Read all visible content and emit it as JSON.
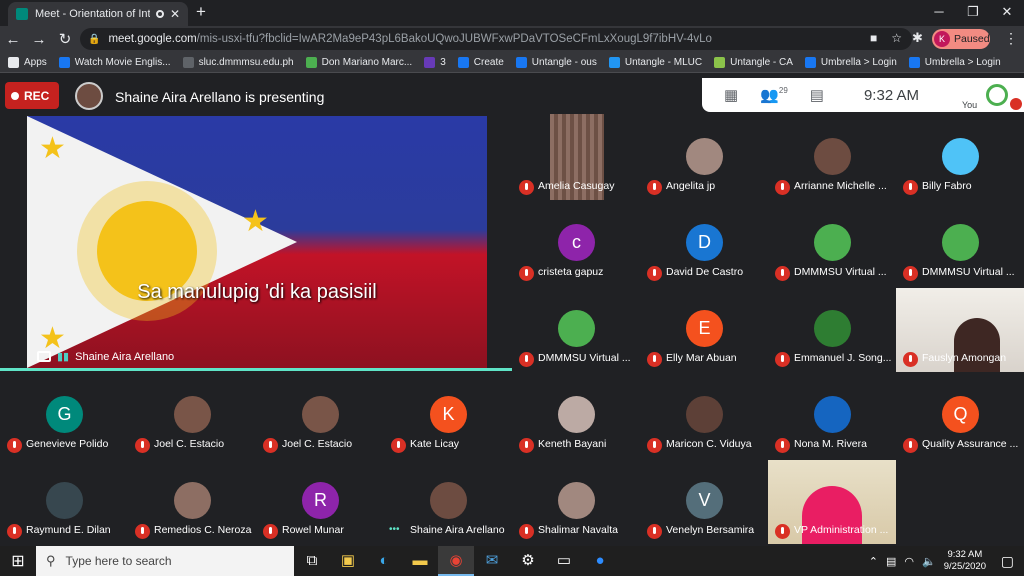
{
  "browser": {
    "tab_title": "Meet - Orientation of Interna",
    "url_host": "meet.google.com",
    "url_path": "/mis-usxi-tfu?fbclid=IwAR2Ma9eP43pL6BakoUQwoJUBWFxwPDaVTOSeCFmLxXougL9f7ibHV-4vLo",
    "profile_initial": "K",
    "profile_status": "Paused",
    "bookmarks": [
      {
        "label": "Apps",
        "icon": "apps-grid-icon",
        "color": "#e8eaed"
      },
      {
        "label": "Watch Movie Englis...",
        "icon": "facebook-icon",
        "color": "#1877f2"
      },
      {
        "label": "sluc.dmmmsu.edu.ph",
        "icon": "globe-icon",
        "color": "#5f6368"
      },
      {
        "label": "Don Mariano Marc...",
        "icon": "school-logo-icon",
        "color": "#4caf50"
      },
      {
        "label": "3",
        "icon": "form-icon",
        "color": "#673ab7"
      },
      {
        "label": "Create",
        "icon": "facebook-icon",
        "color": "#1877f2"
      },
      {
        "label": "Untangle - ous",
        "icon": "facebook-icon",
        "color": "#1877f2"
      },
      {
        "label": "Untangle - MLUC",
        "icon": "s-logo-icon",
        "color": "#2196f3"
      },
      {
        "label": "Untangle - CA",
        "icon": "untangle-logo-icon",
        "color": "#8bc34a"
      },
      {
        "label": "Umbrella > Login",
        "icon": "facebook-icon",
        "color": "#1877f2"
      },
      {
        "label": "Umbrella > Login",
        "icon": "facebook-icon",
        "color": "#1877f2"
      }
    ]
  },
  "meet": {
    "rec_label": "REC",
    "presenting_text": "Shaine Aira Arellano is presenting",
    "participant_count": "29",
    "time": "9:32 AM",
    "you_label": "You",
    "lyric": "Sa manulupig 'di ka pasisiil",
    "share_label": "Shaine Aira Arellano",
    "participants": [
      {
        "name": "Amelia Casugay",
        "initial": "",
        "color": "#8d6e63"
      },
      {
        "name": "Angelita jp",
        "initial": "",
        "color": "#a1887f"
      },
      {
        "name": "Arrianne Michelle ...",
        "initial": "",
        "color": "#6d4c41"
      },
      {
        "name": "Billy Fabro",
        "initial": "",
        "color": "#4fc3f7"
      },
      {
        "name": "cristeta gapuz",
        "initial": "c",
        "color": "#8e24aa"
      },
      {
        "name": "David De Castro",
        "initial": "D",
        "color": "#1976d2"
      },
      {
        "name": "DMMMSU Virtual ...",
        "initial": "",
        "color": "#4caf50"
      },
      {
        "name": "DMMMSU Virtual ...",
        "initial": "",
        "color": "#4caf50"
      },
      {
        "name": "DMMMSU Virtual ...",
        "initial": "",
        "color": "#4caf50"
      },
      {
        "name": "Elly Mar Abuan",
        "initial": "E",
        "color": "#f4511e"
      },
      {
        "name": "Emmanuel J. Song...",
        "initial": "",
        "color": "#2e7d32"
      },
      {
        "name": "Fauslyn Amongan",
        "initial": "",
        "color": "#d7ccc8"
      },
      {
        "name": "Genevieve Polido",
        "initial": "G",
        "color": "#00897b"
      },
      {
        "name": "Joel C. Estacio",
        "initial": "",
        "color": "#795548"
      },
      {
        "name": "Joel C. Estacio",
        "initial": "",
        "color": "#795548"
      },
      {
        "name": "Kate Licay",
        "initial": "K",
        "color": "#f4511e"
      },
      {
        "name": "Keneth Bayani",
        "initial": "",
        "color": "#bcaaa4"
      },
      {
        "name": "Maricon C. Viduya",
        "initial": "",
        "color": "#5d4037"
      },
      {
        "name": "Nona M. Rivera",
        "initial": "",
        "color": "#1565c0"
      },
      {
        "name": "Quality Assurance ...",
        "initial": "Q",
        "color": "#f4511e"
      },
      {
        "name": "Raymund E. Dilan",
        "initial": "",
        "color": "#37474f"
      },
      {
        "name": "Remedios C. Neroza",
        "initial": "",
        "color": "#8d6e63"
      },
      {
        "name": "Rowel Munar",
        "initial": "R",
        "color": "#8e24aa"
      },
      {
        "name": "Shaine Aira Arellano",
        "initial": "",
        "color": "#6d4c41"
      },
      {
        "name": "Shalimar Navalta",
        "initial": "",
        "color": "#a1887f"
      },
      {
        "name": "Venelyn Bersamira",
        "initial": "V",
        "color": "#546e7a"
      },
      {
        "name": "VP Administration ...",
        "initial": "",
        "color": "#e91e63"
      }
    ]
  },
  "taskbar": {
    "search_placeholder": "Type here to search",
    "clock_time": "9:32 AM",
    "clock_date": "9/25/2020"
  }
}
